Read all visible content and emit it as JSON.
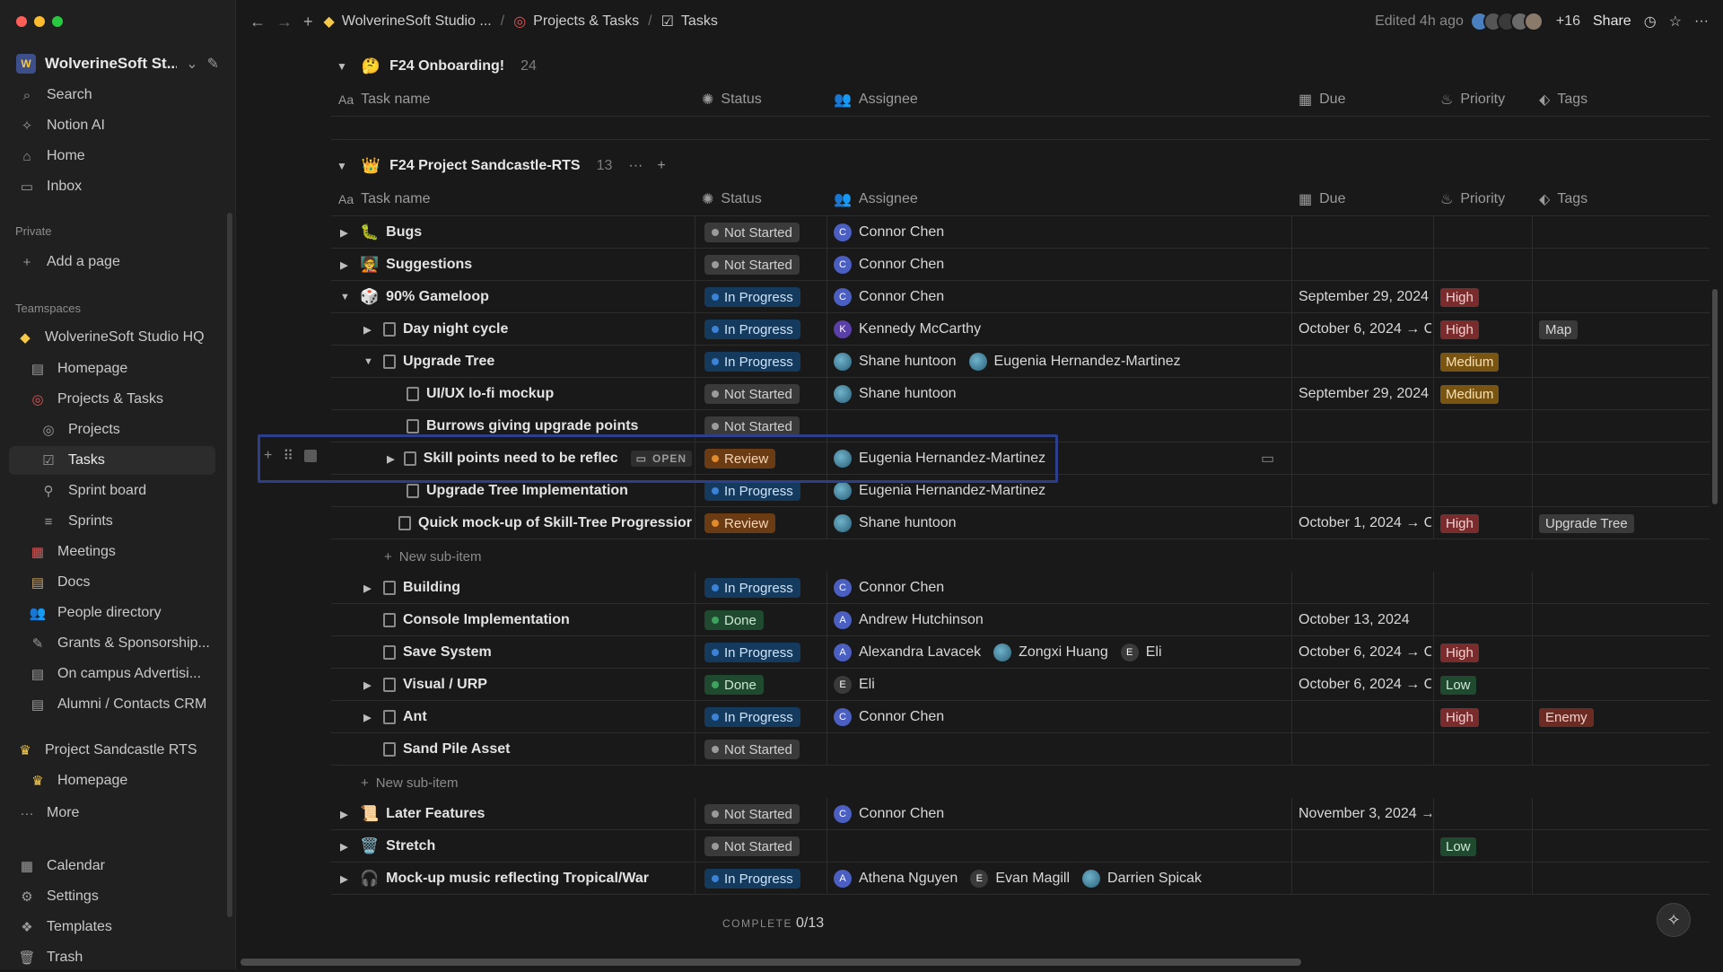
{
  "sidebar": {
    "workspace": "WolverineSoft St...",
    "items": [
      {
        "label": "Search",
        "icon": "search-icon"
      },
      {
        "label": "Notion AI",
        "icon": "notion-ai-icon"
      },
      {
        "label": "Home",
        "icon": "home-icon"
      },
      {
        "label": "Inbox",
        "icon": "inbox-icon"
      }
    ],
    "private_label": "Private",
    "add_page": "Add a page",
    "teamspaces_label": "Teamspaces",
    "teamspace_items": [
      {
        "label": "WolverineSoft Studio HQ"
      },
      {
        "label": "Homepage"
      },
      {
        "label": "Projects & Tasks"
      },
      {
        "label": "Projects"
      },
      {
        "label": "Tasks"
      },
      {
        "label": "Sprint board"
      },
      {
        "label": "Sprints"
      },
      {
        "label": "Meetings"
      },
      {
        "label": "Docs"
      },
      {
        "label": "People directory"
      },
      {
        "label": "Grants & Sponsorship..."
      },
      {
        "label": "On campus Advertisi..."
      },
      {
        "label": "Alumni / Contacts CRM"
      },
      {
        "label": "Project Sandcastle RTS"
      },
      {
        "label": "Homepage"
      },
      {
        "label": "More"
      }
    ],
    "bottom_items": [
      {
        "label": "Calendar"
      },
      {
        "label": "Settings"
      },
      {
        "label": "Templates"
      },
      {
        "label": "Trash"
      }
    ]
  },
  "topbar": {
    "crumb1": "WolverineSoft Studio ...",
    "crumb2": "Projects & Tasks",
    "crumb3": "Tasks",
    "edited": "Edited 4h ago",
    "avatar_count": "+16",
    "share": "Share"
  },
  "columns": {
    "task": "Task name",
    "status": "Status",
    "assignee": "Assignee",
    "due": "Due",
    "priority": "Priority",
    "tags": "Tags",
    "task_prefix": "Aa"
  },
  "group1": {
    "title": "F24 Onboarding!",
    "emoji": "🤔",
    "count": "24"
  },
  "group2": {
    "title": "F24 Project Sandcastle-RTS",
    "emoji": "👑",
    "count": "13"
  },
  "rows": [
    {
      "name": "Bugs",
      "emoji": "🐛",
      "status": "Not Started",
      "assignees": [
        {
          "name": "Connor Chen",
          "init": "C"
        }
      ],
      "due": "",
      "priority": "",
      "tag": ""
    },
    {
      "name": "Suggestions",
      "emoji": "🧑‍🏫",
      "status": "Not Started",
      "assignees": [
        {
          "name": "Connor Chen",
          "init": "C"
        }
      ],
      "due": "",
      "priority": "",
      "tag": ""
    },
    {
      "name": "90% Gameloop",
      "emoji": "🎲",
      "status": "In Progress",
      "assignees": [
        {
          "name": "Connor Chen",
          "init": "C"
        }
      ],
      "due": "September 29, 2024",
      "priority": "High",
      "tag": ""
    },
    {
      "name": "Day night cycle",
      "status": "In Progress",
      "assignees": [
        {
          "name": "Kennedy McCarthy",
          "init": "K"
        }
      ],
      "due": "October 6, 2024 → C",
      "priority": "High",
      "tag": "Map"
    },
    {
      "name": "Upgrade Tree",
      "status": "In Progress",
      "assignees": [
        {
          "name": "Shane huntoon",
          "init": ""
        },
        {
          "name": "Eugenia Hernandez-Martinez",
          "init": ""
        }
      ],
      "due": "",
      "priority": "Medium",
      "tag": ""
    },
    {
      "name": "UI/UX lo-fi mockup",
      "status": "Not Started",
      "assignees": [
        {
          "name": "Shane huntoon",
          "init": ""
        }
      ],
      "due": "September 29, 2024",
      "priority": "Medium",
      "tag": ""
    },
    {
      "name": "Burrows giving upgrade points",
      "status": "Not Started",
      "assignees": [],
      "due": "",
      "priority": "",
      "tag": ""
    },
    {
      "name": "Skill points need to be reflec",
      "status": "Review",
      "assignees": [
        {
          "name": "Eugenia Hernandez-Martinez",
          "init": ""
        }
      ],
      "due": "",
      "priority": "",
      "tag": "",
      "open": "OPEN"
    },
    {
      "name": "Upgrade Tree Implementation",
      "status": "In Progress",
      "assignees": [
        {
          "name": "Eugenia Hernandez-Martinez",
          "init": ""
        }
      ],
      "due": "",
      "priority": "",
      "tag": ""
    },
    {
      "name": "Quick mock-up of Skill-Tree Progressior",
      "status": "Review",
      "assignees": [
        {
          "name": "Shane huntoon",
          "init": ""
        }
      ],
      "due": "October 1, 2024 → C",
      "priority": "High",
      "tag": "Upgrade Tree"
    },
    {
      "name": "Building",
      "status": "In Progress",
      "assignees": [
        {
          "name": "Connor Chen",
          "init": "C"
        }
      ],
      "due": "",
      "priority": "",
      "tag": ""
    },
    {
      "name": "Console Implementation",
      "status": "Done",
      "assignees": [
        {
          "name": "Andrew Hutchinson",
          "init": "A"
        }
      ],
      "due": "October 13, 2024",
      "priority": "",
      "tag": ""
    },
    {
      "name": "Save System",
      "status": "In Progress",
      "assignees": [
        {
          "name": "Alexandra Lavacek",
          "init": "A"
        },
        {
          "name": "Zongxi Huang",
          "init": ""
        },
        {
          "name": "Eli",
          "init": "E"
        }
      ],
      "due": "October 6, 2024 → C",
      "priority": "High",
      "tag": ""
    },
    {
      "name": "Visual / URP",
      "status": "Done",
      "assignees": [
        {
          "name": "Eli",
          "init": "E"
        }
      ],
      "due": "October 6, 2024 → C",
      "priority": "Low",
      "tag": ""
    },
    {
      "name": "Ant",
      "status": "In Progress",
      "assignees": [
        {
          "name": "Connor Chen",
          "init": "C"
        }
      ],
      "due": "",
      "priority": "High",
      "tag": "Enemy"
    },
    {
      "name": "Sand Pile Asset",
      "status": "Not Started",
      "assignees": [],
      "due": "",
      "priority": "",
      "tag": ""
    },
    {
      "name": "Later Features",
      "emoji": "📜",
      "status": "Not Started",
      "assignees": [
        {
          "name": "Connor Chen",
          "init": "C"
        }
      ],
      "due": "November 3, 2024 →",
      "priority": "",
      "tag": ""
    },
    {
      "name": "Stretch",
      "emoji": "🗑️",
      "status": "Not Started",
      "assignees": [],
      "due": "",
      "priority": "Low",
      "tag": ""
    },
    {
      "name": "Mock-up music reflecting Tropical/War",
      "emoji": "🎧",
      "status": "In Progress",
      "assignees": [
        {
          "name": "Athena Nguyen",
          "init": "A"
        },
        {
          "name": "Evan Magill",
          "init": "E"
        },
        {
          "name": "Darrien Spicak",
          "init": ""
        }
      ],
      "due": "",
      "priority": "",
      "tag": ""
    }
  ],
  "new_sub_item": "New sub-item",
  "footer": {
    "label": "COMPLETE",
    "value": "0/13"
  }
}
